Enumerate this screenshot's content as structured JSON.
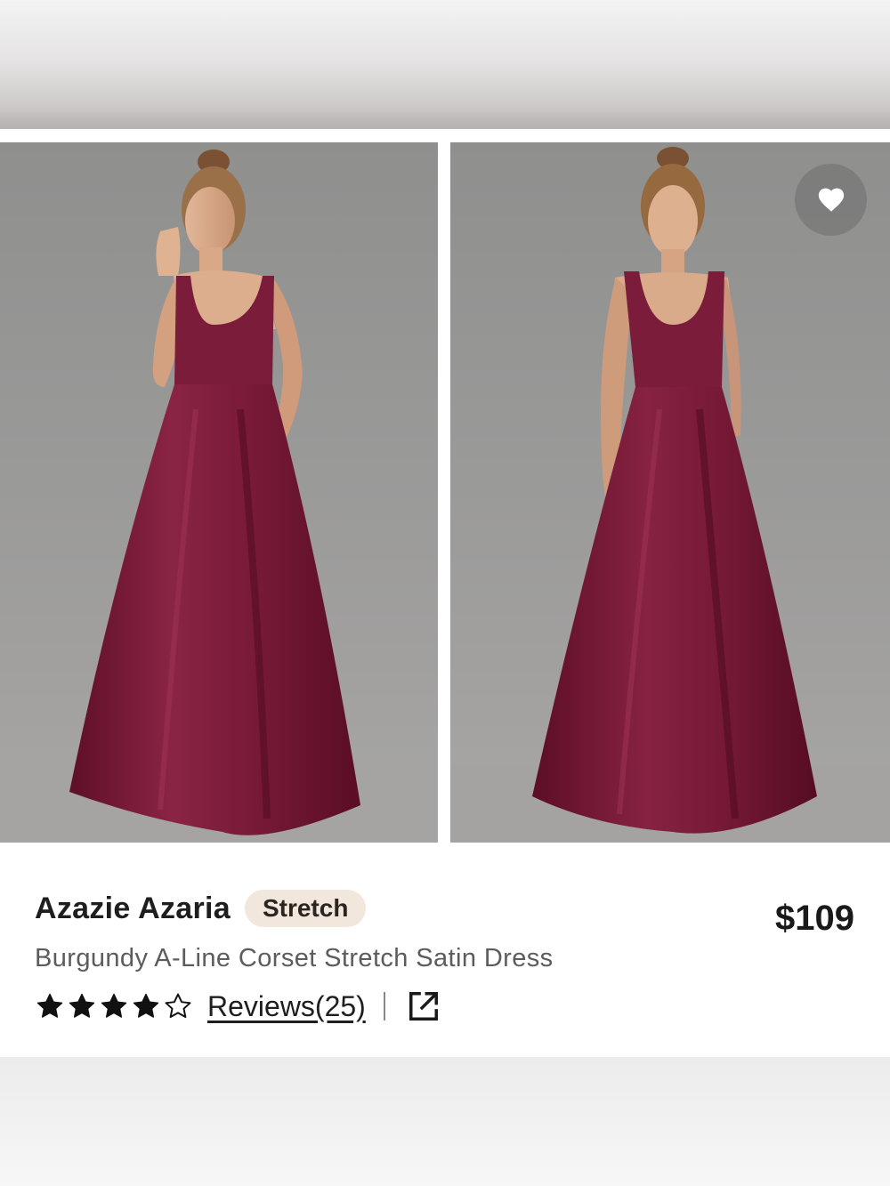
{
  "colors": {
    "dress": "#7d1e3a",
    "backdrop": "#989796",
    "tag_bg": "#f1e7dd",
    "star": "#111111"
  },
  "gallery": {
    "images": [
      {
        "alt": "model-front-pose",
        "icon": "photo"
      },
      {
        "alt": "model-front-view",
        "icon": "photo"
      }
    ],
    "favorite_icon": "heart-icon"
  },
  "product": {
    "brand": "Azazie Azaria",
    "tag": "Stretch",
    "price": "$109",
    "name": "Burgundy A-Line Corset Stretch Satin Dress",
    "rating": 4,
    "rating_max": 5,
    "reviews_label": "Reviews(25)",
    "share_icon": "external-link-icon"
  }
}
